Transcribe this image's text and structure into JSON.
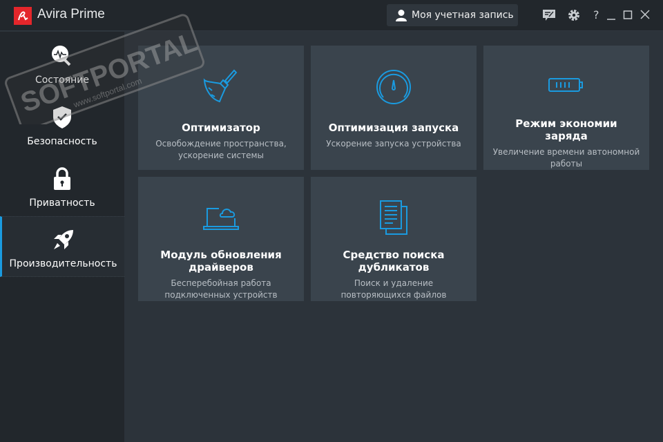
{
  "app": {
    "title": "Avira Prime"
  },
  "header": {
    "account_label": "Моя учетная запись",
    "help": "?"
  },
  "sidebar": {
    "items": [
      {
        "label": "Состояние",
        "icon": "status-pulse-icon"
      },
      {
        "label": "Безопасность",
        "icon": "shield-check-icon"
      },
      {
        "label": "Приватность",
        "icon": "lock-icon"
      },
      {
        "label": "Производительность",
        "icon": "rocket-icon",
        "active": true
      }
    ]
  },
  "tiles": [
    {
      "title": "Оптимизатор",
      "desc": "Освобождение пространства, ускорение системы",
      "icon": "broom-icon"
    },
    {
      "title": "Оптимизация запуска",
      "desc": "Ускорение запуска устройства",
      "icon": "speedometer-icon"
    },
    {
      "title": "Режим экономии заряда",
      "desc": "Увеличение времени автономной работы",
      "icon": "battery-icon"
    },
    {
      "title": "Модуль обновления драйверов",
      "desc": "Бесперебойная работа подключенных устройств",
      "icon": "laptop-cloud-icon"
    },
    {
      "title": "Средство поиска дубликатов",
      "desc": "Поиск и удаление повторяющихся файлов",
      "icon": "duplicate-files-icon"
    }
  ],
  "watermark": {
    "text": "SOFTPORTAL",
    "url": "www.softportal.com"
  },
  "colors": {
    "accent": "#1a9be0",
    "brand": "#e4262b",
    "tile": "#3a444d",
    "sidebar": "#22272c",
    "background": "#2c333a"
  }
}
